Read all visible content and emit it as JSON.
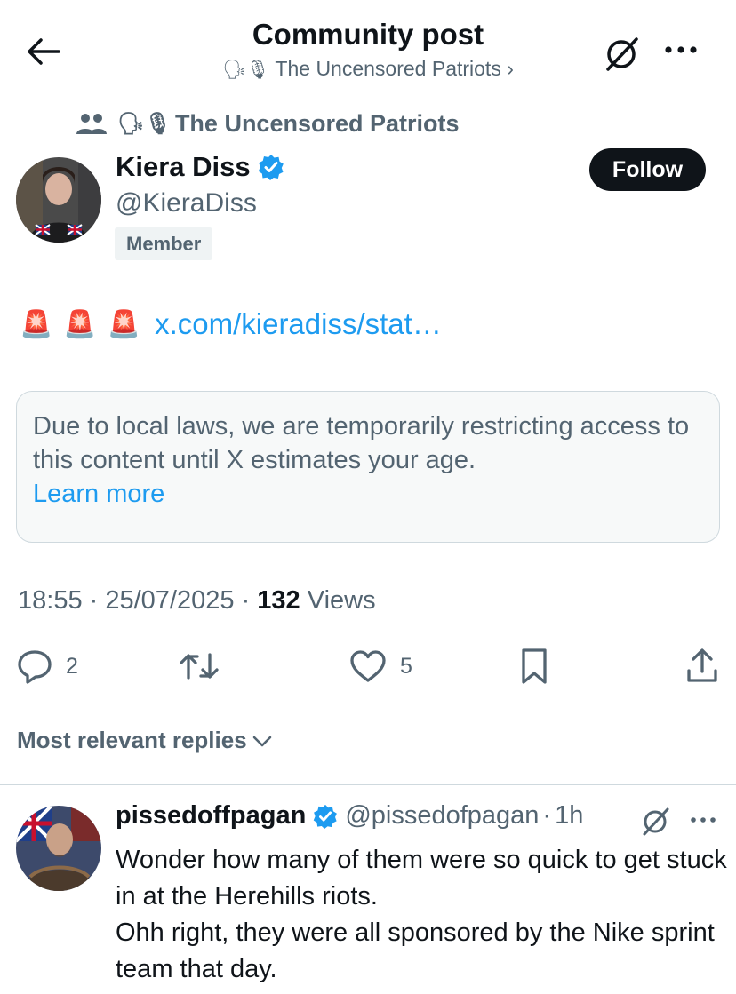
{
  "header": {
    "title": "Community post",
    "community_emoji": "🗣🎙",
    "community_name": "The Uncensored Patriots",
    "chevron": "›"
  },
  "community_line": {
    "emoji": "🗣🎙",
    "name": "The Uncensored Patriots"
  },
  "author": {
    "name": "Kiera Diss",
    "handle": "@KieraDiss",
    "badge": "Member",
    "follow_label": "Follow"
  },
  "post": {
    "sirens": [
      "🚨",
      "🚨",
      "🚨"
    ],
    "link": "x.com/kieradiss/stat…"
  },
  "notice": {
    "text": "Due to local laws, we are temporarily restricting access to this content until X estimates your age.",
    "learn_more": "Learn more"
  },
  "meta": {
    "time": "18:55",
    "sep1": " · ",
    "date": "25/07/2025",
    "sep2": " · ",
    "views_count": "132",
    "views_label": "Views"
  },
  "actions": {
    "replies": "2",
    "likes": "5"
  },
  "replies_sort": "Most relevant replies",
  "reply": {
    "name": "pissedoffpagan",
    "handle": "@pissedofpagan",
    "dot": "·",
    "time": "1h",
    "text_line1": "Wonder how many of them were so quick to get stuck in at the Herehills riots.",
    "text_line2": "Ohh right, they were all sponsored by the Nike sprint team that day."
  },
  "colors": {
    "accent": "#1d9bf0",
    "muted": "#536471",
    "text": "#0f1419",
    "verified": "#1d9bf0"
  },
  "icons": [
    "back-arrow-icon",
    "grok-icon",
    "more-icon",
    "community-icon",
    "verified-icon",
    "reply-icon",
    "repost-icon",
    "like-icon",
    "bookmark-icon",
    "share-icon",
    "chevron-down-icon"
  ]
}
